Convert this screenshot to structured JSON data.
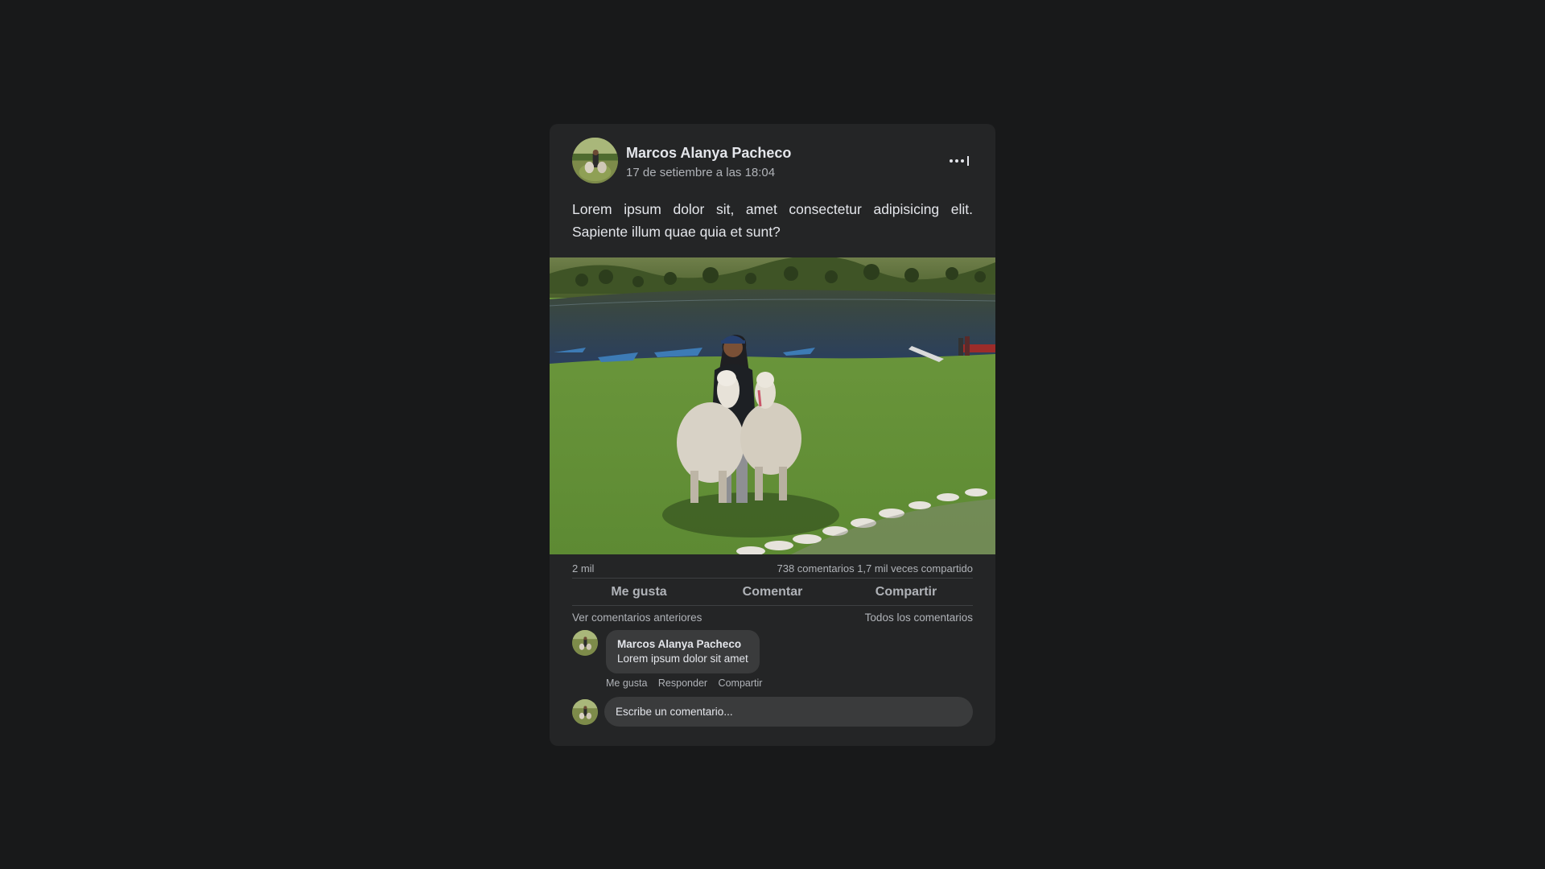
{
  "post": {
    "author": "Marcos Alanya Pacheco",
    "timestamp": "17 de setiembre a las 18:04",
    "text": "Lorem ipsum dolor sit, amet consectetur adipisicing elit. Sapiente illum quae quia et sunt?",
    "more_icon": "more-options-icon",
    "image_description_icon": "photo-image"
  },
  "stats": {
    "likes": "2 mil",
    "comments_and_shares": "738 comentarios 1,7 mil veces compartido"
  },
  "actions": {
    "like": "Me gusta",
    "comment": "Comentar",
    "share": "Compartir"
  },
  "comments_nav": {
    "previous": "Ver comentarios anteriores",
    "all": "Todos los comentarios"
  },
  "comment": {
    "author": "Marcos Alanya Pacheco",
    "text": "Lorem ipsum dolor sit amet",
    "actions": {
      "like": "Me gusta",
      "reply": "Responder",
      "share": "Compartir"
    }
  },
  "composer": {
    "placeholder": "Escribe un comentario..."
  },
  "colors": {
    "page_background": "#18191a",
    "card_background": "#242526",
    "bubble_background": "#3a3b3c",
    "primary_text": "#e4e6eb",
    "secondary_text": "#b0b3b8"
  }
}
